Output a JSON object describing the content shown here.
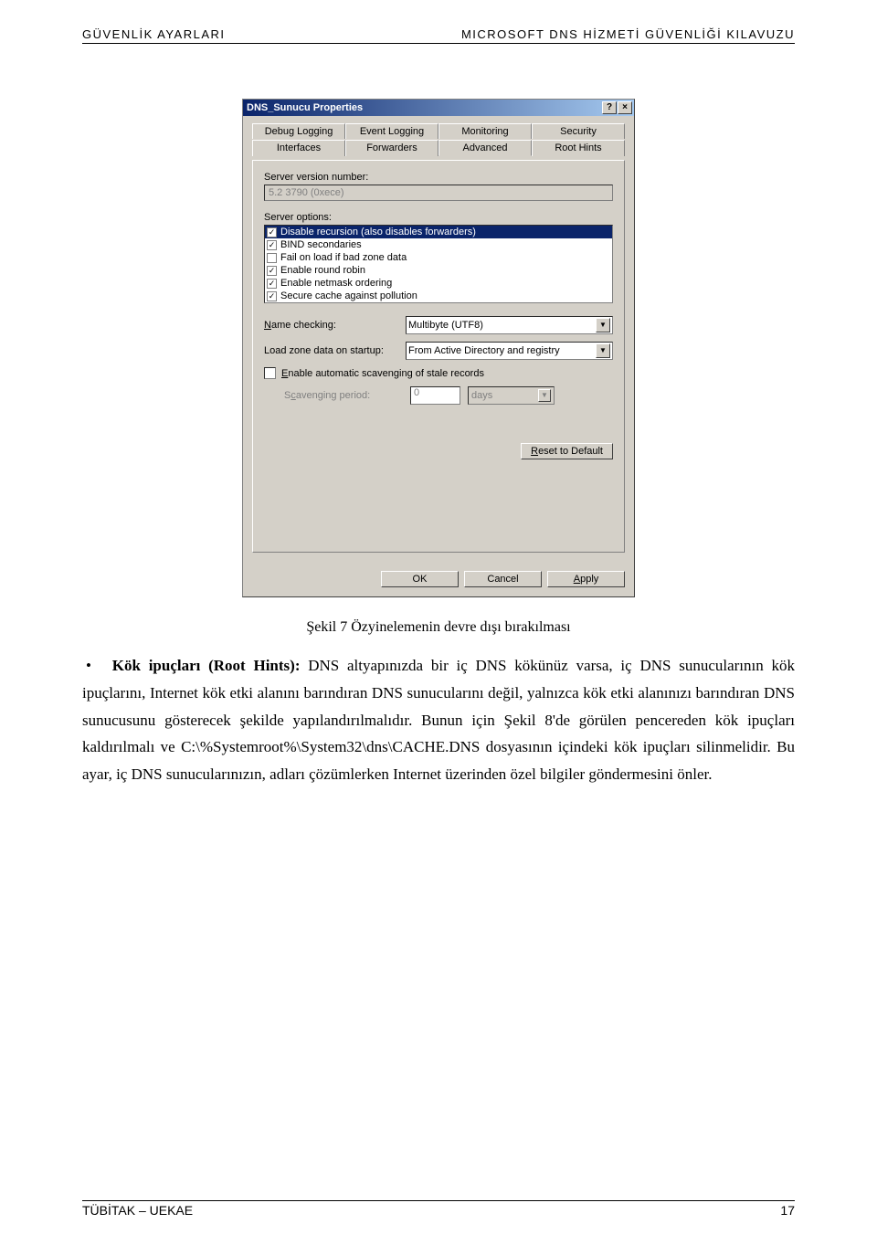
{
  "header": {
    "left": "GÜVENLİK AYARLARI",
    "right": "MICROSOFT DNS HİZMETİ GÜVENLİĞİ KILAVUZU"
  },
  "dialog": {
    "title": "DNS_Sunucu Properties",
    "help_glyph": "?",
    "close_glyph": "×",
    "tabs_row1": [
      "Debug Logging",
      "Event Logging",
      "Monitoring",
      "Security"
    ],
    "tabs_row2": [
      "Interfaces",
      "Forwarders",
      "Advanced",
      "Root Hints"
    ],
    "active_tab": "Advanced",
    "server_version_label": "Server version number:",
    "server_version_value": "5.2 3790 (0xece)",
    "server_options_label": "Server options:",
    "options": [
      {
        "checked": true,
        "label": "Disable recursion (also disables forwarders)",
        "selected": true
      },
      {
        "checked": true,
        "label": "BIND secondaries",
        "selected": false
      },
      {
        "checked": false,
        "label": "Fail on load if bad zone data",
        "selected": false
      },
      {
        "checked": true,
        "label": "Enable round robin",
        "selected": false
      },
      {
        "checked": true,
        "label": "Enable netmask ordering",
        "selected": false
      },
      {
        "checked": true,
        "label": "Secure cache against pollution",
        "selected": false
      }
    ],
    "name_checking_label": "Name checking:",
    "name_checking_value": "Multibyte (UTF8)",
    "load_zone_label": "Load zone data on startup:",
    "load_zone_value": "From Active Directory and registry",
    "scavenge_checkbox_label": "Enable automatic scavenging of stale records",
    "scavenge_period_label": "Scavenging period:",
    "scavenge_value": "0",
    "scavenge_unit": "days",
    "reset_label": "Reset to Default",
    "ok_label": "OK",
    "cancel_label": "Cancel",
    "apply_label": "Apply"
  },
  "caption": "Şekil  7 Özyinelemenin devre dışı bırakılması",
  "paragraph": {
    "bullet_title": "Kök ipuçları (Root Hints):",
    "text": "DNS altyapınızda bir iç DNS kökünüz varsa, iç DNS sunucularının kök ipuçlarını, Internet kök etki alanını barındıran DNS sunucularını değil, yalnızca kök etki alanınızı barındıran DNS sunucusunu gösterecek şekilde yapılandırılmalıdır. Bunun için Şekil  8'de görülen pencereden kök ipuçları kaldırılmalı ve C:\\%Systemroot%\\System32\\dns\\CACHE.DNS dosyasının içindeki kök ipuçları silinmelidir. Bu ayar, iç DNS sunucularınızın, adları çözümlerken Internet üzerinden özel bilgiler göndermesini önler."
  },
  "footer": {
    "left": "TÜBİTAK – UEKAE",
    "right": "17"
  }
}
